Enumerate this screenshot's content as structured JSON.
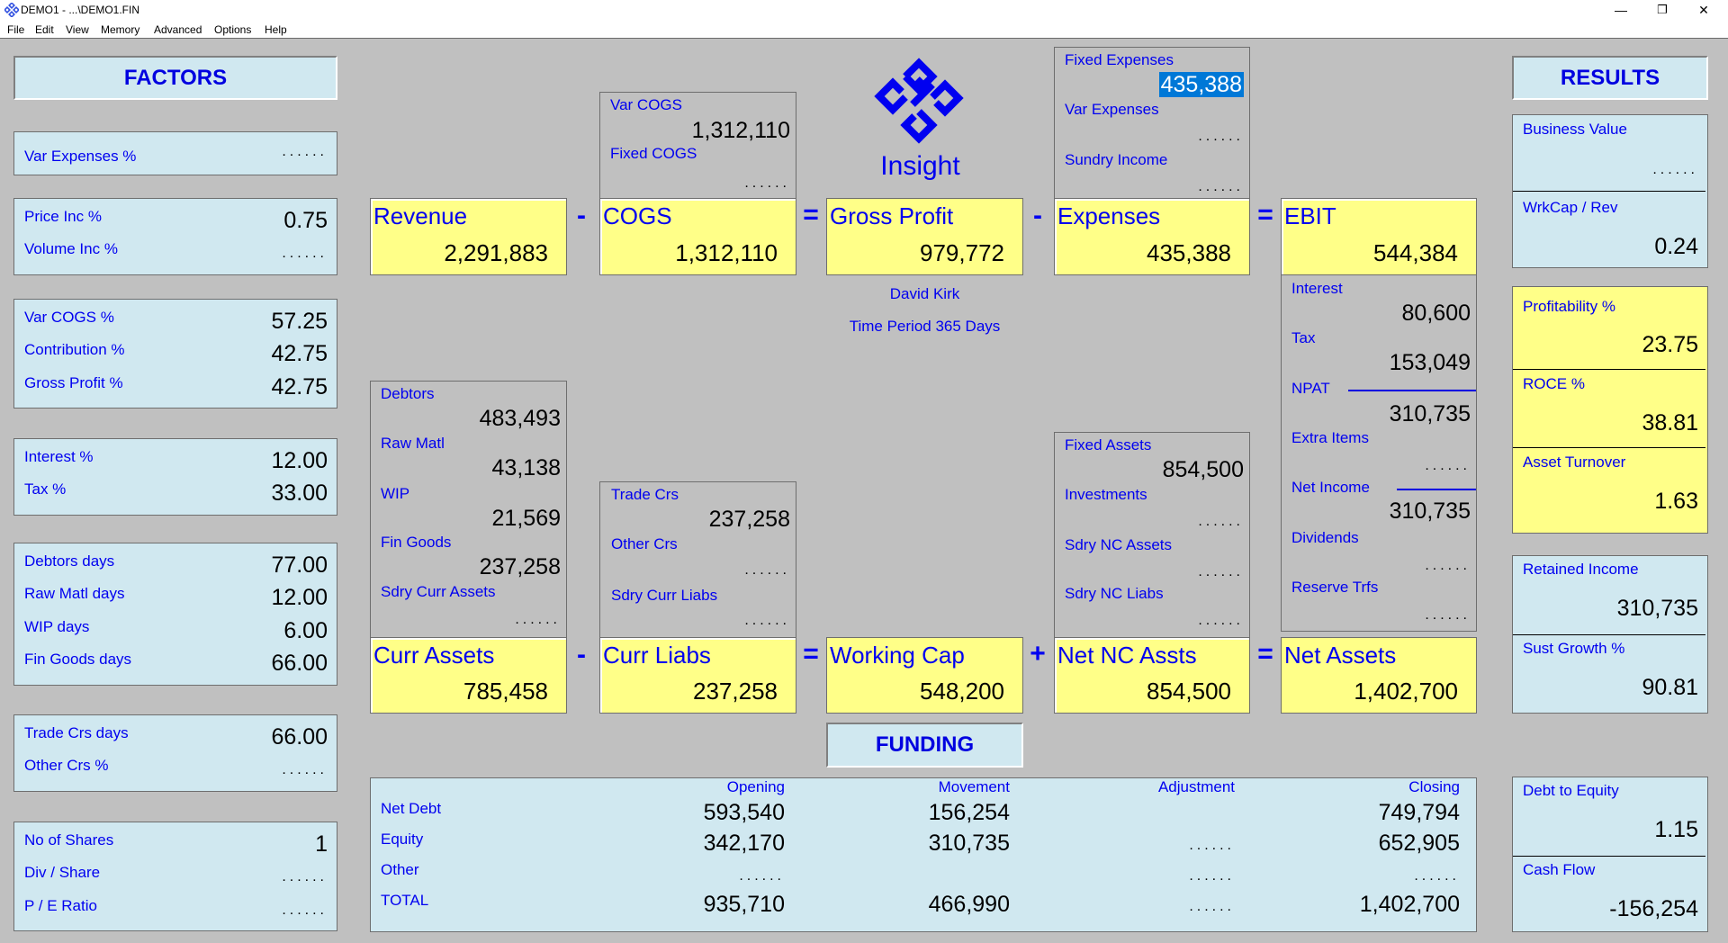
{
  "window": {
    "title": "DEMO1 - ...\\DEMO1.FIN",
    "minimize": "—",
    "restore": "❐",
    "close": "✕"
  },
  "menu": [
    "File",
    "Edit",
    "View",
    "Memory",
    "Advanced",
    "Options",
    "Help"
  ],
  "empty_value": "......",
  "factors": {
    "header": "FACTORS",
    "var_expenses_pct": {
      "label": "Var Expenses %",
      "value": null
    },
    "price_inc_pct": {
      "label": "Price Inc %",
      "value": "0.75"
    },
    "volume_inc_pct": {
      "label": "Volume Inc %",
      "value": null
    },
    "var_cogs_pct": {
      "label": "Var COGS %",
      "value": "57.25"
    },
    "contribution_pct": {
      "label": "Contribution %",
      "value": "42.75"
    },
    "gross_profit_pct": {
      "label": "Gross Profit %",
      "value": "42.75"
    },
    "interest_pct": {
      "label": "Interest %",
      "value": "12.00"
    },
    "tax_pct": {
      "label": "Tax %",
      "value": "33.00"
    },
    "debtors_days": {
      "label": "Debtors days",
      "value": "77.00"
    },
    "raw_matl_days": {
      "label": "Raw Matl days",
      "value": "12.00"
    },
    "wip_days": {
      "label": "WIP days",
      "value": "6.00"
    },
    "fin_goods_days": {
      "label": "Fin Goods days",
      "value": "66.00"
    },
    "trade_crs_days": {
      "label": "Trade Crs days",
      "value": "66.00"
    },
    "other_crs_pct": {
      "label": "Other Crs %",
      "value": null
    },
    "no_of_shares": {
      "label": "No of Shares",
      "value": "1"
    },
    "div_share": {
      "label": "Div / Share",
      "value": null
    },
    "pe_ratio": {
      "label": "P / E Ratio",
      "value": null
    }
  },
  "logo": {
    "text": "Insight"
  },
  "info": {
    "author": "David Kirk",
    "period": "Time Period 365 Days"
  },
  "income": {
    "revenue": {
      "label": "Revenue",
      "value": "2,291,883"
    },
    "cogs": {
      "label": "COGS",
      "value": "1,312,110"
    },
    "gross_profit": {
      "label": "Gross Profit",
      "value": "979,772"
    },
    "expenses": {
      "label": "Expenses",
      "value": "435,388"
    },
    "ebit": {
      "label": "EBIT",
      "value": "544,384"
    },
    "op_minus": "-",
    "op_equals": "=",
    "op_plus": "+",
    "var_cogs": {
      "label": "Var COGS",
      "value": "1,312,110"
    },
    "fixed_cogs": {
      "label": "Fixed COGS",
      "value": null
    },
    "fixed_expenses": {
      "label": "Fixed Expenses",
      "value": "435,388"
    },
    "var_expenses": {
      "label": "Var Expenses",
      "value": null
    },
    "sundry_income": {
      "label": "Sundry Income",
      "value": null
    },
    "interest": {
      "label": "Interest",
      "value": "80,600"
    },
    "tax": {
      "label": "Tax",
      "value": "153,049"
    },
    "npat": {
      "label": "NPAT",
      "value": "310,735"
    },
    "extra_items": {
      "label": "Extra Items",
      "value": null
    },
    "net_income": {
      "label": "Net Income",
      "value": "310,735"
    },
    "dividends": {
      "label": "Dividends",
      "value": null
    },
    "reserve_trfs": {
      "label": "Reserve Trfs",
      "value": null
    }
  },
  "balance": {
    "debtors": {
      "label": "Debtors",
      "value": "483,493"
    },
    "raw_matl": {
      "label": "Raw Matl",
      "value": "43,138"
    },
    "wip": {
      "label": "WIP",
      "value": "21,569"
    },
    "fin_goods": {
      "label": "Fin Goods",
      "value": "237,258"
    },
    "sdry_curr_assets": {
      "label": "Sdry Curr Assets",
      "value": null
    },
    "trade_crs": {
      "label": "Trade Crs",
      "value": "237,258"
    },
    "other_crs": {
      "label": "Other Crs",
      "value": null
    },
    "sdry_curr_liabs": {
      "label": "Sdry Curr Liabs",
      "value": null
    },
    "fixed_assets": {
      "label": "Fixed Assets",
      "value": "854,500"
    },
    "investments": {
      "label": "Investments",
      "value": null
    },
    "sdry_nc_assets": {
      "label": "Sdry NC Assets",
      "value": null
    },
    "sdry_nc_liabs": {
      "label": "Sdry NC Liabs",
      "value": null
    },
    "curr_assets": {
      "label": "Curr Assets",
      "value": "785,458"
    },
    "curr_liabs": {
      "label": "Curr Liabs",
      "value": "237,258"
    },
    "working_cap": {
      "label": "Working Cap",
      "value": "548,200"
    },
    "net_nc_assts": {
      "label": "Net NC Assts",
      "value": "854,500"
    },
    "net_assets": {
      "label": "Net Assets",
      "value": "1,402,700"
    }
  },
  "funding": {
    "header": "FUNDING",
    "columns": [
      "Opening",
      "Movement",
      "Adjustment",
      "Closing"
    ],
    "rows": [
      {
        "label": "Net Debt",
        "values": [
          "593,540",
          "156,254",
          "",
          "749,794"
        ]
      },
      {
        "label": "Equity",
        "values": [
          "342,170",
          "310,735",
          "......",
          "652,905"
        ]
      },
      {
        "label": "Other",
        "values": [
          "......",
          "",
          "......",
          "......"
        ]
      },
      {
        "label": "TOTAL",
        "values": [
          "935,710",
          "466,990",
          "......",
          "1,402,700"
        ]
      }
    ]
  },
  "results": {
    "header": "RESULTS",
    "business_value": {
      "label": "Business Value",
      "value": null
    },
    "wrkcap_rev": {
      "label": "WrkCap / Rev",
      "value": "0.24"
    },
    "profitability_pct": {
      "label": "Profitability %",
      "value": "23.75"
    },
    "roce_pct": {
      "label": "ROCE %",
      "value": "38.81"
    },
    "asset_turnover": {
      "label": "Asset Turnover",
      "value": "1.63"
    },
    "retained_income": {
      "label": "Retained Income",
      "value": "310,735"
    },
    "sust_growth_pct": {
      "label": "Sust Growth %",
      "value": "90.81"
    },
    "debt_to_equity": {
      "label": "Debt to Equity",
      "value": "1.15"
    },
    "cash_flow": {
      "label": "Cash Flow",
      "value": "-156,254"
    }
  },
  "colors": {
    "label_blue": "#0000f0",
    "panel_blue": "#d0e8f0",
    "panel_yellow": "#ffff88",
    "background": "#c0c0c0",
    "selection": "#0078d7"
  }
}
